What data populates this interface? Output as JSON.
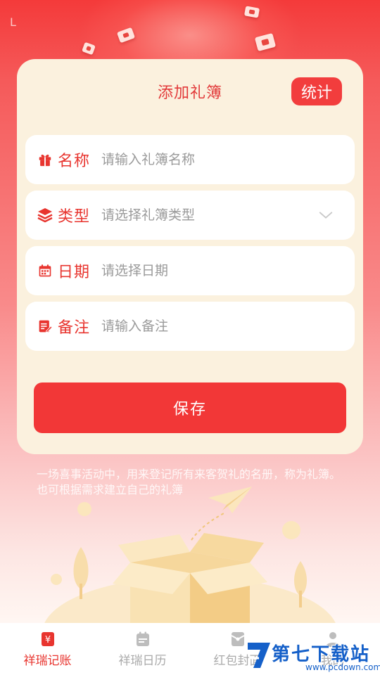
{
  "status": {
    "mark": "L"
  },
  "form": {
    "title": "添加礼簿",
    "stats_label": "统计",
    "fields": [
      {
        "label": "名称",
        "placeholder": "请输入礼簿名称",
        "icon": "gift-icon"
      },
      {
        "label": "类型",
        "placeholder": "请选择礼簿类型",
        "icon": "layers-icon"
      },
      {
        "label": "日期",
        "placeholder": "请选择日期",
        "icon": "calendar-icon"
      },
      {
        "label": "备注",
        "placeholder": "请输入备注",
        "icon": "note-edit-icon"
      }
    ],
    "save_label": "保存"
  },
  "description": "一场喜事活动中，用来登记所有来客贺礼的名册，称为礼簿。也可根据需求建立自己的礼簿",
  "tabbar": {
    "items": [
      {
        "label": "祥瑞记账",
        "icon": "yen-note-icon",
        "active": true
      },
      {
        "label": "祥瑞日历",
        "icon": "calendar-icon",
        "active": false
      },
      {
        "label": "红包封面",
        "icon": "red-envelope-icon",
        "active": false
      },
      {
        "label": "我的",
        "icon": "person-icon",
        "active": false
      }
    ]
  },
  "watermark": {
    "text": "第七下载站",
    "url": "www.pcdown.com"
  },
  "colors": {
    "accent": "#f23737",
    "card": "#fbf1de",
    "label": "#e8352f",
    "tab_inactive": "#aaaaaa"
  }
}
